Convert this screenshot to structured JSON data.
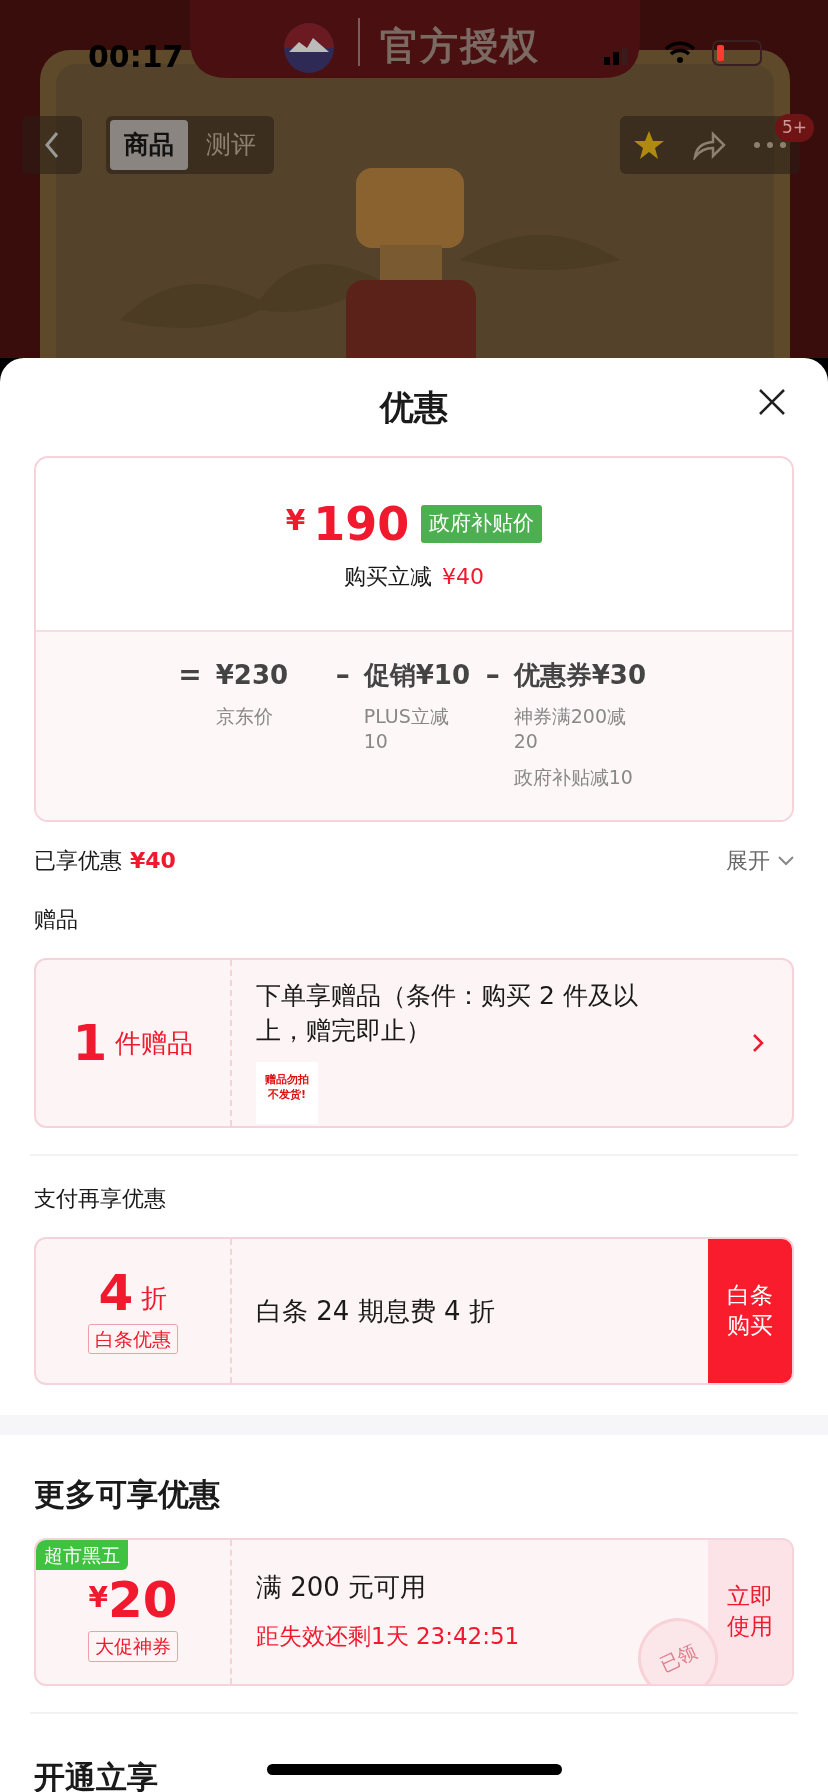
{
  "status_bar": {
    "time": "00:17"
  },
  "header": {
    "title": "官方授权"
  },
  "nav": {
    "tabs": [
      {
        "label": "商品",
        "selected": true
      },
      {
        "label": "测评",
        "selected": false
      }
    ],
    "badge": "5+"
  },
  "sheet": {
    "title": "优惠"
  },
  "price_card": {
    "currency": "¥",
    "price": "190",
    "tag": "政府补贴价",
    "instant_label": "购买立减",
    "instant_amount": "¥40",
    "breakdown": [
      {
        "op": "=",
        "amount": "¥230",
        "notes": [
          "京东价"
        ]
      },
      {
        "op": "–",
        "amount": "促销¥10",
        "notes": [
          "PLUS立减10"
        ]
      },
      {
        "op": "–",
        "amount": "优惠券¥30",
        "notes": [
          "神券满200减20",
          "政府补贴减10"
        ]
      }
    ]
  },
  "enjoyed": {
    "label": "已享优惠",
    "amount": "¥40",
    "expand": "展开"
  },
  "gifts": {
    "heading": "赠品",
    "count": "1",
    "unit": "件赠品",
    "text": "下单享赠品（条件：购买 2 件及以上，赠完即止）",
    "thumb_text": "赠品勿拍不发货!"
  },
  "pay": {
    "heading": "支付再享优惠",
    "value": "4",
    "unit": "折",
    "tag": "白条优惠",
    "text": "白条 24 期息费 4 折",
    "button": "白条购买"
  },
  "more": {
    "heading": "更多可享优惠",
    "coupons": [
      {
        "ribbon": "超市黑五",
        "currency": "¥",
        "amount": "20",
        "tag": "大促神券",
        "condition": "满 200 元可用",
        "expiry": "距失效还剩1天 23:42:51",
        "button": "立即使用",
        "stamp": "已领"
      }
    ]
  },
  "next_section": {
    "heading": "开通立享"
  }
}
